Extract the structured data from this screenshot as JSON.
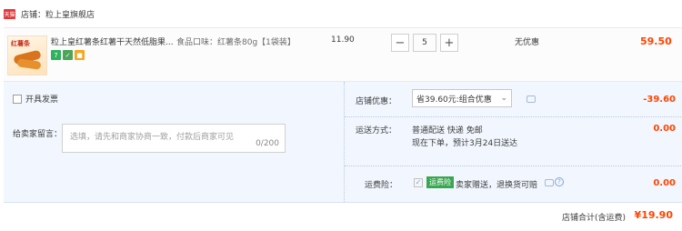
{
  "shop": {
    "badge": "天猫",
    "label": "店铺：",
    "name": "粒上皇旗舰店"
  },
  "item": {
    "thumb_brand": "红薯条",
    "title": "粒上皇红薯条红薯干天然低脂果...",
    "sku": "食品口味：红薯条80g【1袋装】",
    "unit_price": "11.90",
    "quantity": "5",
    "qty_minus": "−",
    "qty_plus": "+",
    "promotion": "无优惠",
    "subtotal": "59.50",
    "service_icons": [
      "7",
      "✓",
      "■"
    ]
  },
  "invoice": {
    "label": "开具发票"
  },
  "message": {
    "label": "给卖家留言：",
    "placeholder": "选填，请先和商家协商一致，付款后商家可见",
    "counter": "0/200"
  },
  "shop_discount": {
    "label": "店铺优惠：",
    "selected": "省39.60元:组合优惠",
    "amount": "-39.60"
  },
  "shipping": {
    "label": "运送方式：",
    "method": "普通配送 快递 免邮",
    "eta": "现在下单，预计3月24日送达",
    "fee": "0.00"
  },
  "insurance": {
    "label": "运费险：",
    "badge": "运费险",
    "desc": "卖家赠送，退换货可赔",
    "help": "?",
    "fee": "0.00"
  },
  "total": {
    "label": "店铺合计(含运费)",
    "value": "¥19.90"
  },
  "colors": {
    "accent": "#ff4400",
    "panel_bg": "#f2f7ff",
    "tmall_red": "#e4393c"
  }
}
